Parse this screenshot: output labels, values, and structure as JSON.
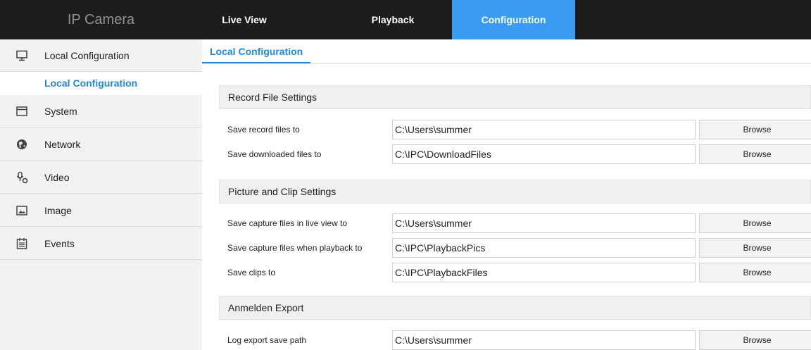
{
  "header": {
    "brand": "IP Camera",
    "tabs": [
      {
        "label": "Live View"
      },
      {
        "label": "Playback"
      },
      {
        "label": "Configuration",
        "active": true
      }
    ]
  },
  "sidebar": {
    "items": [
      {
        "label": "Local Configuration",
        "icon": "monitor-icon"
      },
      {
        "label": "System",
        "icon": "window-icon"
      },
      {
        "label": "Network",
        "icon": "globe-icon"
      },
      {
        "label": "Video",
        "icon": "video-settings-icon"
      },
      {
        "label": "Image",
        "icon": "image-icon"
      },
      {
        "label": "Events",
        "icon": "calendar-icon"
      }
    ],
    "sub_item": "Local Configuration"
  },
  "main": {
    "tab": "Local Configuration",
    "browse_label": "Browse",
    "sections": [
      {
        "title": "Record File Settings",
        "rows": [
          {
            "label": "Save record files to",
            "value": "C:\\Users\\summer"
          },
          {
            "label": "Save downloaded files to",
            "value": "C:\\IPC\\DownloadFiles"
          }
        ]
      },
      {
        "title": "Picture and Clip Settings",
        "rows": [
          {
            "label": "Save capture files in live view to",
            "value": "C:\\Users\\summer"
          },
          {
            "label": "Save capture files when playback to",
            "value": "C:\\IPC\\PlaybackPics"
          },
          {
            "label": "Save clips to",
            "value": "C:\\IPC\\PlaybackFiles"
          }
        ]
      },
      {
        "title": "Anmelden Export",
        "rows": [
          {
            "label": "Log export save path",
            "value": "C:\\Users\\summer"
          }
        ]
      }
    ]
  },
  "colors": {
    "topbar": "#1c1c1c",
    "accent": "#3a9cf0",
    "link": "#1e88e5",
    "sidebar_bg": "#f2f2f2"
  }
}
